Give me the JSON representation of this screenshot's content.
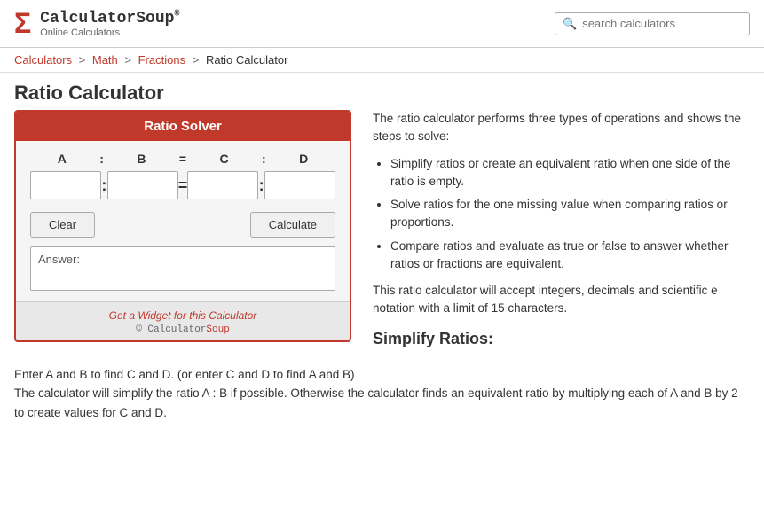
{
  "header": {
    "logo_sigma": "Σ",
    "logo_title": "CalculatorSoup",
    "logo_trademark": "®",
    "logo_subtitle": "Online Calculators",
    "search_placeholder": "search calculators"
  },
  "breadcrumb": {
    "items": [
      {
        "label": "Calculators",
        "href": "#"
      },
      {
        "label": "Math",
        "href": "#"
      },
      {
        "label": "Fractions",
        "href": "#"
      },
      {
        "label": "Ratio Calculator",
        "href": null
      }
    ]
  },
  "page_title": "Ratio Calculator",
  "calculator": {
    "title": "Ratio Solver",
    "labels": [
      "A",
      "B",
      "C",
      "D"
    ],
    "clear_button": "Clear",
    "calculate_button": "Calculate",
    "answer_label": "Answer:",
    "widget_link_text": "Get a Widget for this Calculator",
    "copyright_text": "© CalculatorSoup"
  },
  "description": {
    "intro": "The ratio calculator performs three types of operations and shows the steps to solve:",
    "bullets": [
      "Simplify ratios or create an equivalent ratio when one side of the ratio is empty.",
      "Solve ratios for the one missing value when comparing ratios or proportions.",
      "Compare ratios and evaluate as true or false to answer whether ratios or fractions are equivalent."
    ],
    "note": "This ratio calculator will accept integers, decimals and scientific e notation with a limit of 15 characters.",
    "simplify_heading": "Simplify Ratios:"
  },
  "bottom_text": {
    "line1": "Enter A and B to find C and D. (or enter C and D to find A and B)",
    "line2": "The calculator will simplify the ratio A : B if possible. Otherwise the calculator finds an equivalent ratio by multiplying each of A and B by 2 to create values for C and D."
  }
}
